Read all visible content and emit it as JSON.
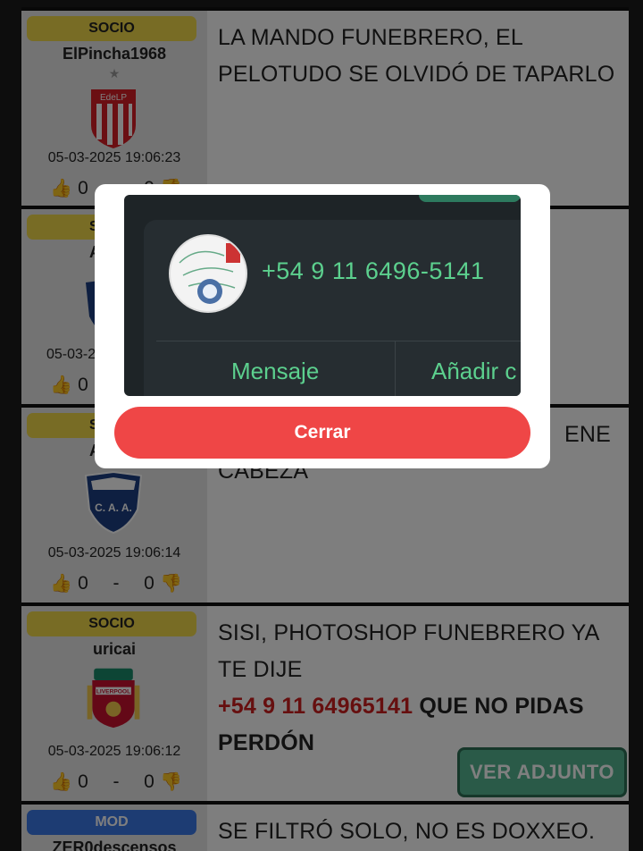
{
  "posts": [
    {
      "badge": "SOCIO",
      "username": "ElPincha1968",
      "star": "★",
      "crest": "EdeLP",
      "date": "05-03-2025 19:06:23",
      "likes": "0",
      "dislikes": "0",
      "text": "LA MANDO FUNEBRERO, EL PELOTUDO SE OLVIDÓ DE TAPARLO"
    },
    {
      "badge": "S",
      "username": "A",
      "date": "05-03-2",
      "likes": "0",
      "dislikes": "0",
      "text": ""
    },
    {
      "badge": "S",
      "username": "A",
      "crest": "C. A. A.",
      "date": "05-03-2025 19:06:14",
      "likes": "0",
      "dislikes": "0",
      "text_visible_1": "ENE",
      "text_visible_2": "CABEZA"
    },
    {
      "badge": "SOCIO",
      "username": "uricai",
      "crest": "LIVERPOOL",
      "date": "05-03-2025 19:06:12",
      "likes": "0",
      "dislikes": "0",
      "text_plain": "SISI, PHOTOSHOP FUNEBRERO YA TE DIJE",
      "text_phone": "+54 9 11 64965141",
      "text_bold": " QUE NO PIDAS PERDÓN",
      "attachment_label": "VER ADJUNTO"
    },
    {
      "badge": "MOD",
      "username": "ZER0descensos",
      "text": "SE FILTRÓ SOLO, NO ES DOXXEO."
    }
  ],
  "modal": {
    "phone": "+54 9 11 6496-5141",
    "action_message": "Mensaje",
    "action_add": "Añadir c",
    "close_label": "Cerrar"
  },
  "colors": {
    "socio_badge": "#f0d84a",
    "mod_badge": "#3a78e6",
    "close_button": "#ef4646",
    "whatsapp_green": "#5cd08e",
    "attachment_button": "#55b590"
  },
  "icons": {
    "like": "thumbs-up-icon",
    "dislike": "thumbs-down-icon"
  }
}
